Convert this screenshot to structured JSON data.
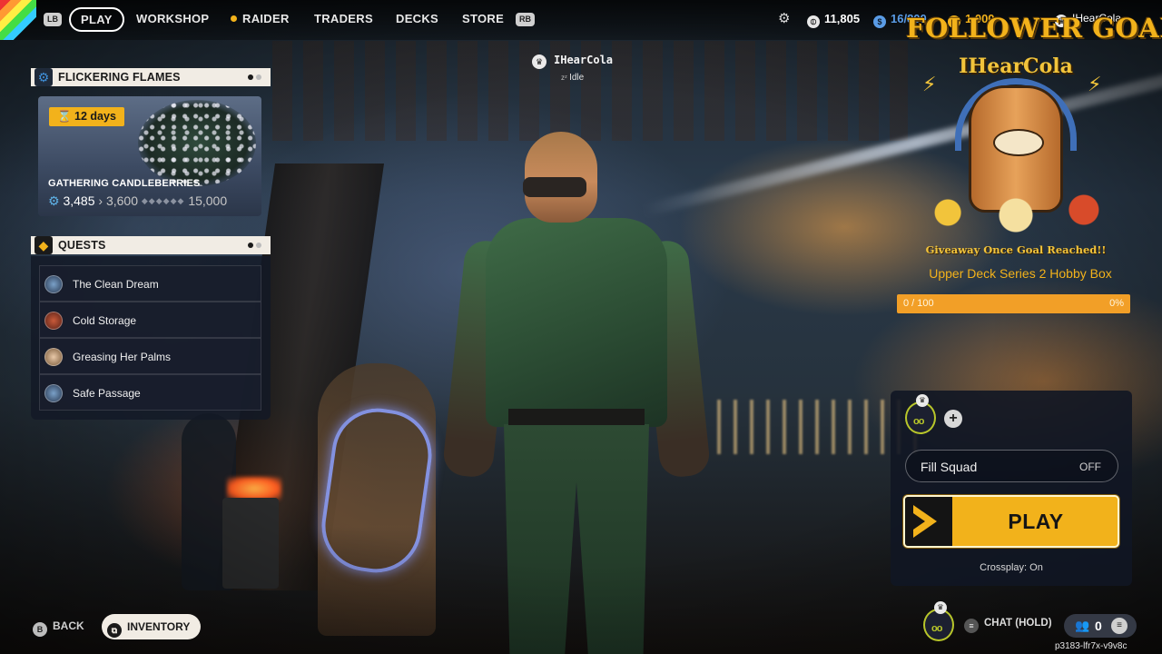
{
  "topnav": {
    "left_bumper": "LB",
    "right_bumper": "RB",
    "tabs": [
      {
        "label": "PLAY",
        "active": true
      },
      {
        "label": "WORKSHOP",
        "active": false
      },
      {
        "label": "RAIDER",
        "active": false
      },
      {
        "label": "TRADERS",
        "active": false
      },
      {
        "label": "DECKS",
        "active": false
      },
      {
        "label": "STORE",
        "active": false
      }
    ],
    "currencies": {
      "coins": "11,805",
      "seeds": "16/800",
      "cred": "1,000"
    },
    "username": "IHearCola"
  },
  "event": {
    "header": "FLICKERING FLAMES",
    "timer": "12 days",
    "title": "GATHERING CANDLEBERRIES",
    "progress_current": "3,485",
    "progress_next": "3,600",
    "progress_max": "15,000"
  },
  "quests": {
    "header": "QUESTS",
    "items": [
      {
        "label": "The Clean Dream"
      },
      {
        "label": "Cold Storage"
      },
      {
        "label": "Greasing Her Palms"
      },
      {
        "label": "Safe Passage"
      }
    ]
  },
  "player": {
    "name": "IHearCola",
    "status": "Idle"
  },
  "follower_goal": {
    "title": "FOLLOWER GOAL",
    "art_name": "IHearCola",
    "caption": "Giveaway Once Goal Reached!!",
    "prize": "Upper Deck Series 2 Hobby Box",
    "count": "0 / 100",
    "percent": "0%",
    "progress_fraction": 0
  },
  "squad": {
    "fill_squad_label": "Fill Squad",
    "fill_squad_value": "OFF",
    "play_label": "PLAY",
    "crossplay": "Crossplay: On"
  },
  "bottom": {
    "back_key": "B",
    "back_label": "BACK",
    "inventory_label": "INVENTORY",
    "chat_label": "CHAT (HOLD)",
    "friends_count": "0",
    "session_code": "p3183-lfr7x-v9v8c"
  },
  "colors": {
    "accent_yellow": "#f2b21b",
    "goal_bar": "#f29f27",
    "panel_header": "#f1ece4"
  }
}
